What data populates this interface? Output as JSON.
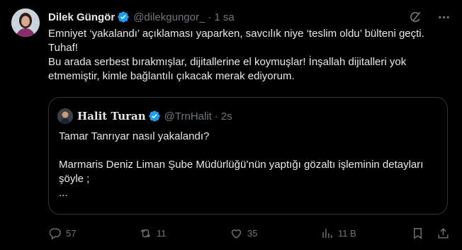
{
  "tweet": {
    "author_name": "Dilek Güngör",
    "author_handle": "@dilekgungor_",
    "separator": "·",
    "time": "1 sa",
    "paragraph1": "Emniyet ‘yakalandı’ açıklaması yaparken, savcılık niye ‘teslim oldu’ bülteni geçti. Tuhaf!",
    "paragraph2": "Bu arada serbest bırakmışlar, dijitallerine el koymuşlar! İnşallah dijitalleri yok etmemiştir, kimle bağlantılı çıkacak merak ediyorum."
  },
  "quoted": {
    "author_name": "Halit Turan",
    "author_handle": "@TrnHalit",
    "separator": "·",
    "time": "2s",
    "line1": "Tamar Tanrıyar nasıl yakalandı?",
    "line2": "Marmaris Deniz Liman Şube Müdürlüğü’nün yaptığı gözaltı işleminin detayları şöyle ;",
    "line3": "..."
  },
  "actions": {
    "replies": "57",
    "reposts": "11",
    "likes": "35",
    "views": "11 B"
  },
  "colors": {
    "background": "#000000",
    "text": "#e7e9ea",
    "muted": "#71767b",
    "verified": "#1d9bf0",
    "border": "#2f3336"
  },
  "icons": [
    "grok-icon",
    "more-icon",
    "reply-icon",
    "repost-icon",
    "like-icon",
    "views-icon",
    "bookmark-icon",
    "share-icon"
  ]
}
